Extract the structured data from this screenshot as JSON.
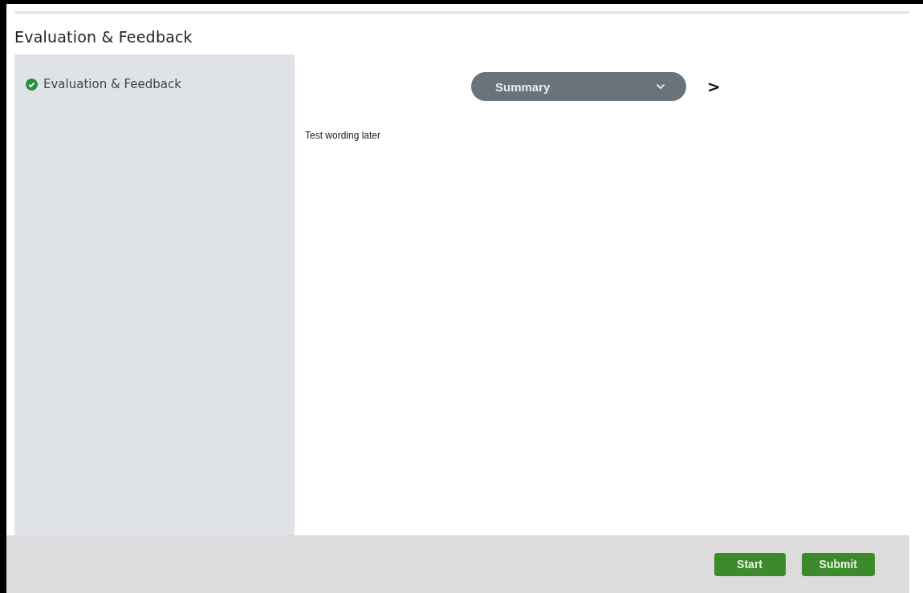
{
  "page": {
    "title": "Evaluation & Feedback"
  },
  "sidebar": {
    "items": [
      {
        "label": "Evaluation & Feedback",
        "completed": true
      }
    ]
  },
  "section_select": {
    "value": "Summary"
  },
  "next_button": {
    "label": ">"
  },
  "content": {
    "text": "Test wording later"
  },
  "footer": {
    "buttons": [
      {
        "label": "Start"
      },
      {
        "label": "Submit"
      }
    ]
  }
}
